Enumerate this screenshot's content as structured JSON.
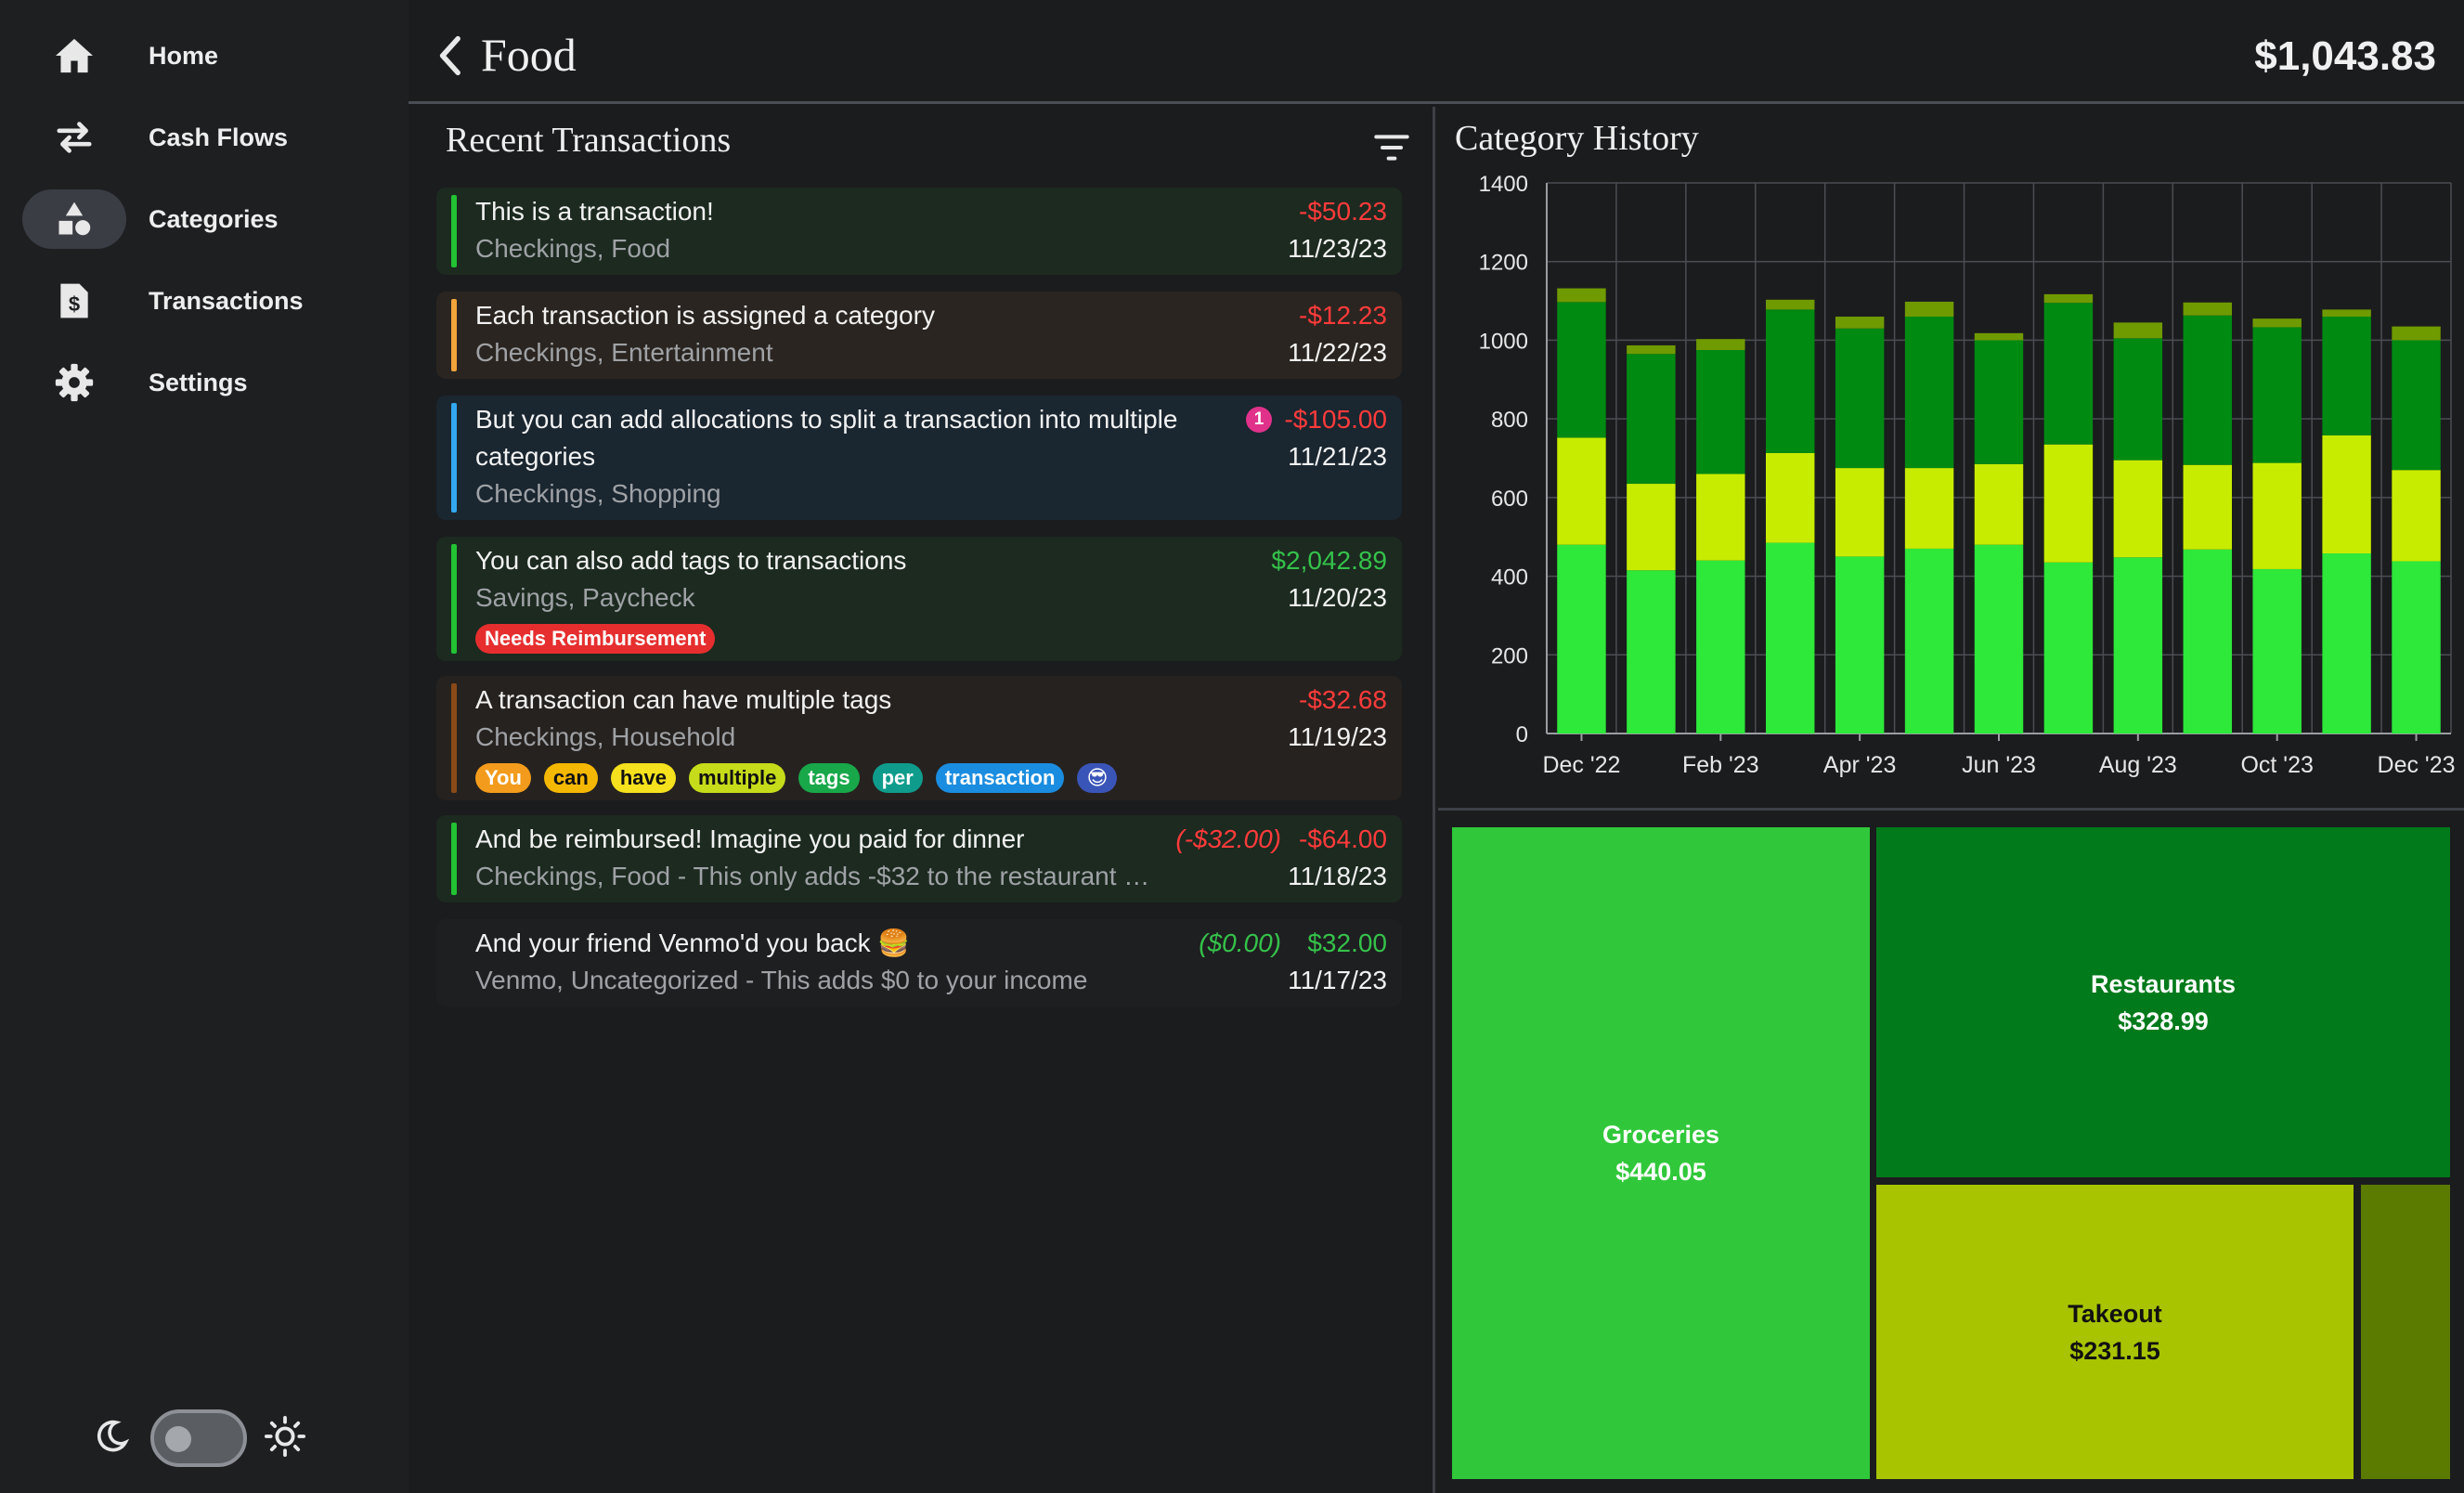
{
  "sidebar": {
    "items": [
      {
        "label": "Home",
        "icon": "home-icon"
      },
      {
        "label": "Cash Flows",
        "icon": "swap-arrows-icon"
      },
      {
        "label": "Categories",
        "icon": "shapes-icon",
        "active": true
      },
      {
        "label": "Transactions",
        "icon": "receipt-dollar-icon"
      },
      {
        "label": "Settings",
        "icon": "gear-icon"
      }
    ],
    "theme_toggle": {
      "left_icon": "moon-icon",
      "right_icon": "sun-icon",
      "state": "dark"
    }
  },
  "header": {
    "title": "Food",
    "total": "$1,043.83"
  },
  "transactions": {
    "title": "Recent Transactions",
    "items": [
      {
        "description": "This is a transaction!",
        "subtitle": "Checkings, Food",
        "amount": "-$50.23",
        "date": "11/23/23",
        "bar_color": "#22c233",
        "bg": "#1c2a20"
      },
      {
        "description": "Each transaction is assigned a category",
        "subtitle": "Checkings, Entertainment",
        "amount": "-$12.23",
        "date": "11/22/23",
        "bar_color": "#f2a33a",
        "bg": "#2a2520"
      },
      {
        "description_line1": "But you can add allocations to split a transaction into multiple",
        "description_line2": "categories",
        "subtitle": "Checkings, Shopping",
        "amount": "-$105.00",
        "date": "11/21/23",
        "allocation_count": "1",
        "bar_color": "#33a8f0",
        "bg": "#1a2630"
      },
      {
        "description": "You can also add tags to transactions",
        "subtitle": "Savings, Paycheck",
        "amount": "$2,042.89",
        "date": "11/20/23",
        "bar_color": "#22c233",
        "bg": "#1c2a20",
        "tags": [
          {
            "label": "Needs Reimbursement",
            "color": "#e62e2e",
            "text": "#ffffff"
          }
        ]
      },
      {
        "description": "A transaction can have multiple tags",
        "subtitle": "Checkings, Household",
        "amount": "-$32.68",
        "date": "11/19/23",
        "bar_color": "#8a4a18",
        "bg": "#26221f",
        "tags": [
          {
            "label": "You",
            "color": "#f39b1c",
            "text": "#ffffff"
          },
          {
            "label": "can",
            "color": "#f5b800",
            "text": "#111111"
          },
          {
            "label": "have",
            "color": "#f5e11d",
            "text": "#111111"
          },
          {
            "label": "multiple",
            "color": "#c6dc1a",
            "text": "#111111"
          },
          {
            "label": "tags",
            "color": "#18a84a",
            "text": "#ffffff"
          },
          {
            "label": "per",
            "color": "#0f9c8c",
            "text": "#ffffff"
          },
          {
            "label": "transaction",
            "color": "#1a8de0",
            "text": "#ffffff"
          },
          {
            "label": "😎",
            "color": "#3a55b8",
            "text": "#ffffff"
          }
        ]
      },
      {
        "description": "And be reimbursed! Imagine you paid for dinner",
        "subtitle": "Checkings, Food - This only adds -$32 to the restaurant …",
        "reimbursement": "(-$32.00)",
        "amount": "-$64.00",
        "date": "11/18/23",
        "bar_color": "#22c233",
        "bg": "#1c2a20"
      },
      {
        "description": "And your friend Venmo'd you back 🍔",
        "subtitle": "Venmo, Uncategorized - This adds $0 to your income",
        "reimbursement": "($0.00)",
        "amount": "$32.00",
        "date": "11/17/23",
        "bar_color": "none",
        "bg": "#1e1f21"
      }
    ]
  },
  "chart": {
    "title": "Category History"
  },
  "chart_data": {
    "type": "bar",
    "stacked": true,
    "categories": [
      "Dec '22",
      "Jan '23",
      "Feb '23",
      "Mar '23",
      "Apr '23",
      "May '23",
      "Jun '23",
      "Jul '23",
      "Aug '23",
      "Sep '23",
      "Oct '23",
      "Nov '23",
      "Dec '23"
    ],
    "x_tick_labels": [
      "Dec '22",
      "Feb '23",
      "Apr '23",
      "Jun '23",
      "Aug '23",
      "Oct '23",
      "Dec '23"
    ],
    "series": [
      {
        "color": "#2ee83a",
        "values": [
          480,
          415,
          440,
          485,
          450,
          470,
          480,
          435,
          448,
          468,
          418,
          458,
          438
        ]
      },
      {
        "color": "#c8ec00",
        "values": [
          272,
          220,
          220,
          228,
          225,
          205,
          205,
          300,
          247,
          215,
          270,
          300,
          232
        ]
      },
      {
        "color": "#008a12",
        "values": [
          345,
          330,
          315,
          365,
          355,
          385,
          315,
          360,
          310,
          380,
          345,
          302,
          330
        ]
      },
      {
        "color": "#6f9a00",
        "values": [
          35,
          22,
          28,
          25,
          30,
          38,
          18,
          22,
          40,
          33,
          22,
          18,
          35
        ]
      }
    ],
    "ylim": [
      0,
      1400
    ],
    "yticks": [
      0,
      200,
      400,
      600,
      800,
      1000,
      1200,
      1400
    ],
    "grid": true
  },
  "treemap": {
    "cells": [
      {
        "label": "Groceries",
        "value": "$440.05",
        "color": "#30c83a",
        "text": "#ffffff"
      },
      {
        "label": "Restaurants",
        "value": "$328.99",
        "color": "#007a1a",
        "text": "#ffffff"
      },
      {
        "label": "Takeout",
        "value": "$231.15",
        "color": "#a8c400",
        "text": "#111111"
      },
      {
        "label": "",
        "value": "",
        "color": "#5a7a00",
        "text": "#111111"
      }
    ]
  }
}
